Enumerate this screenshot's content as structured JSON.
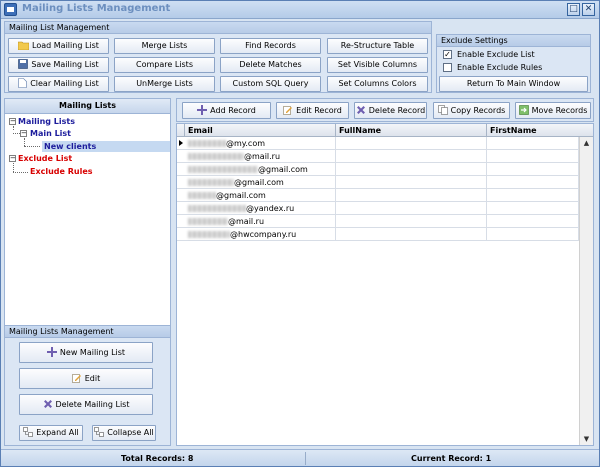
{
  "window": {
    "title": "Mailing Lists Management"
  },
  "mgmt_group": {
    "header": "Mailing List Management",
    "buttons": {
      "load": "Load Mailing List",
      "save": "Save Mailing List",
      "clear": "Clear Mailing List",
      "merge": "Merge Lists",
      "compare": "Compare Lists",
      "unmerge": "UnMerge Lists",
      "find": "Find Records",
      "delete_matches": "Delete Matches",
      "custom_sql": "Custom SQL Query",
      "restructure": "Re-Structure Table",
      "set_visible": "Set Visible Columns",
      "set_colors": "Set Columns Colors"
    }
  },
  "exclude_settings": {
    "header": "Exclude Settings",
    "enable_list": {
      "label": "Enable Exclude List",
      "checked": true,
      "mark": "✓"
    },
    "enable_rules": {
      "label": "Enable Exclude Rules",
      "checked": false,
      "mark": ""
    },
    "return_button": "Return To Main Window"
  },
  "left_pane": {
    "title": "Mailing Lists",
    "tree": {
      "mailing_lists": "Mailing Lists",
      "main_list": "Main List",
      "new_clients": "New clients",
      "exclude_list": "Exclude List",
      "exclude_rules": "Exclude Rules"
    },
    "bottom": {
      "header": "Mailing Lists Management",
      "new_list": "New Mailing List",
      "edit": "Edit",
      "delete_list": "Delete Mailing List",
      "expand_all": "Expand All",
      "collapse_all": "Collapse All"
    }
  },
  "records_toolbar": {
    "add": "Add Record",
    "edit": "Edit Record",
    "delete": "Delete Record",
    "copy": "Copy Records",
    "move": "Move Records"
  },
  "grid": {
    "columns": [
      "Email",
      "FullName",
      "FirstName"
    ],
    "rows": [
      {
        "email_domain": "@my.com"
      },
      {
        "email_domain": "@mail.ru"
      },
      {
        "email_domain": "@gmail.com"
      },
      {
        "email_domain": "@gmail.com"
      },
      {
        "email_domain": "@gmail.com"
      },
      {
        "email_domain": "@yandex.ru"
      },
      {
        "email_domain": "@mail.ru"
      },
      {
        "email_domain": "@hwcompany.ru"
      }
    ]
  },
  "status": {
    "total": "Total Records: 8",
    "current": "Current Record: 1"
  },
  "colors": {
    "tree_blue": "#1c1c9c",
    "tree_red": "#d80000",
    "selected": "#c5d9f1",
    "frame": "#d8e4f2"
  }
}
